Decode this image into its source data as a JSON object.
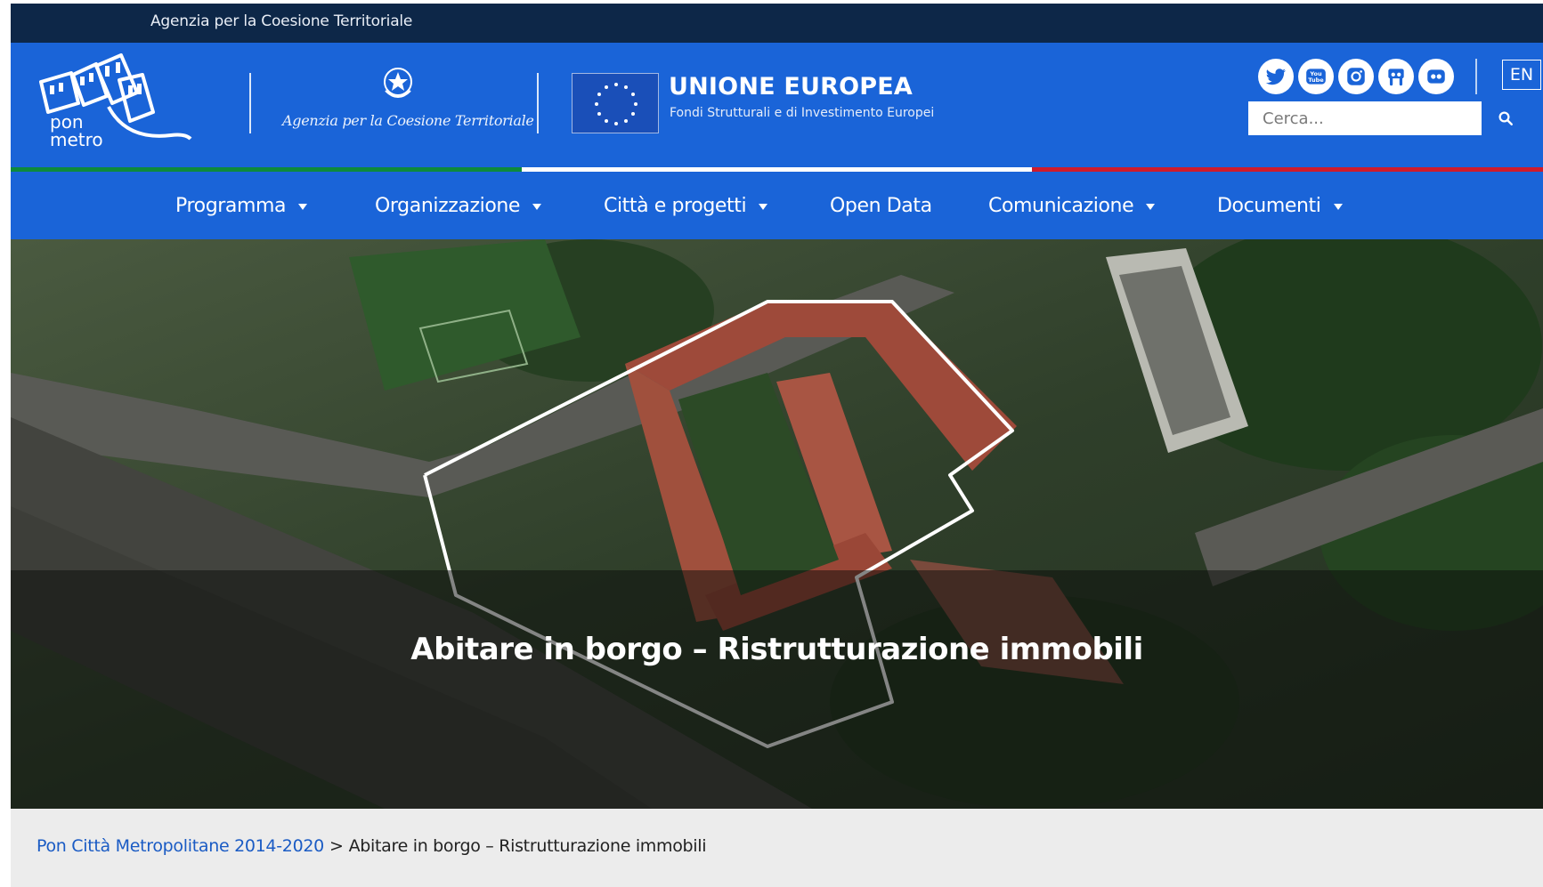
{
  "topbar": {
    "agency_text": "Agenzia per la Coesione Territoriale"
  },
  "header": {
    "pon_logo_text_1": "pon",
    "pon_logo_text_2": "metro",
    "agency_script": "Agenzia per la Coesione Territoriale",
    "eu_title": "UNIONE EUROPEA",
    "eu_subtitle": "Fondi Strutturali e di Investimento Europei",
    "social": [
      "twitter-icon",
      "youtube-icon",
      "instagram-icon",
      "slideshare-icon",
      "flickr-icon"
    ],
    "youtube_text_1": "You",
    "youtube_text_2": "Tube",
    "lang_label": "EN",
    "search_placeholder": "Cerca..."
  },
  "nav": {
    "items": [
      {
        "label": "Programma",
        "has_dropdown": true
      },
      {
        "label": "Organizzazione",
        "has_dropdown": true
      },
      {
        "label": "Città e progetti",
        "has_dropdown": true
      },
      {
        "label": "Open Data",
        "has_dropdown": false
      },
      {
        "label": "Comunicazione",
        "has_dropdown": true
      },
      {
        "label": "Documenti",
        "has_dropdown": true
      }
    ]
  },
  "hero": {
    "title": "Abitare in borgo – Ristrutturazione immobili"
  },
  "breadcrumb": {
    "link": "Pon Città Metropolitane 2014-2020",
    "separator": ">",
    "current": "Abitare in borgo – Ristrutturazione immobili"
  },
  "colors": {
    "brand_blue": "#1a64d8",
    "topbar_navy": "#0d2748",
    "italy_green": "#0d8a3c",
    "italy_red": "#cf1b2b",
    "link_blue": "#1a5bc4"
  }
}
